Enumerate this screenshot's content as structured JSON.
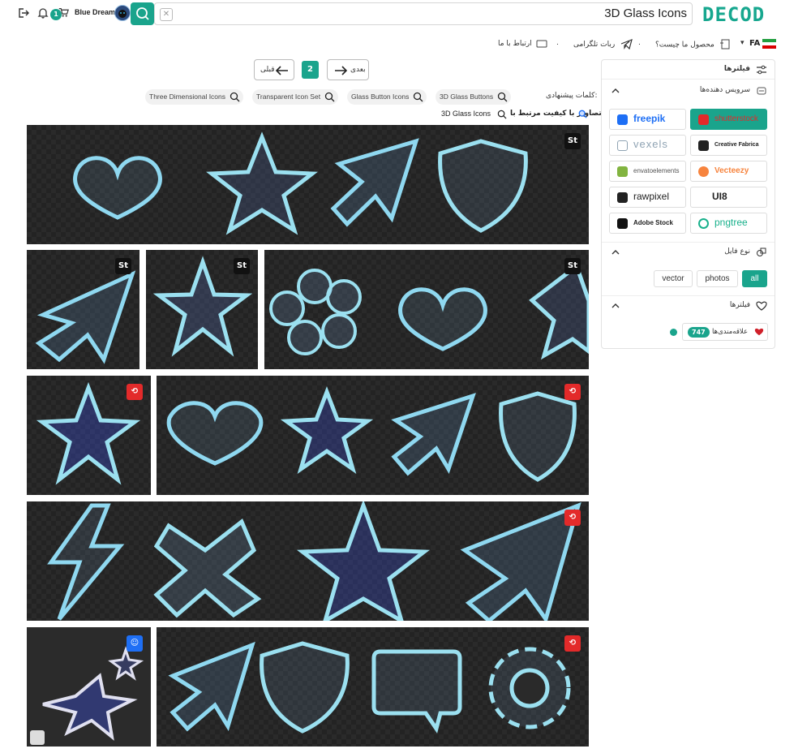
{
  "header": {
    "notification_count": "1",
    "username": "Blue Dream",
    "search_value": "3D Glass Icons",
    "clear_symbol": "✕",
    "logo_text": "DECOD"
  },
  "nav": {
    "lang": "FA",
    "items": [
      "محصول ما چیست؟",
      "ربات تلگرامی",
      "ارتباط با ما"
    ],
    "separator": "."
  },
  "pagination": {
    "prev_label": "قبلی",
    "next_label": "بعدی",
    "current_page": "2"
  },
  "suggestions": {
    "label": "کلمات پیشنهادی:",
    "tags": [
      "Three Dimensional Icons",
      "Transparent Icon Set",
      "Glass Button Icons",
      "3D Glass Buttons"
    ],
    "related_label": "تصاویر با کیفیت مرتبط با",
    "related_query": "3D Glass Icons"
  },
  "results": {
    "tiles": [
      {
        "source": "shutterstock-badge-icon",
        "badge": "St",
        "row": 1
      },
      {
        "source": "adobe-stock-badge-icon",
        "badge": "St",
        "row": 2
      },
      {
        "source": "adobe-stock-badge-icon",
        "badge": "St",
        "row": 2
      },
      {
        "source": "adobe-stock-badge-icon",
        "badge": "St",
        "row": 2
      },
      {
        "source": "shutterstock-badge-icon",
        "badge": "",
        "row": 3
      },
      {
        "source": "shutterstock-badge-icon",
        "badge": "",
        "row": 3
      },
      {
        "source": "shutterstock-badge-icon",
        "badge": "",
        "row": 4
      },
      {
        "source": "freepik-badge-icon",
        "badge": "",
        "row": 5
      },
      {
        "source": "shutterstock-badge-icon",
        "badge": "",
        "row": 5
      }
    ]
  },
  "sidebar": {
    "filters_title": "فیلترها",
    "providers_title": "سرویس دهنده‌ها",
    "providers": [
      {
        "name": "freepik",
        "color": "#1e6ff5",
        "active": false
      },
      {
        "name": "shutterstock",
        "color": "#ffffff",
        "active": true
      },
      {
        "name": "vexels",
        "color": "#8fa3b3",
        "active": false
      },
      {
        "name": "Creative Fabrica",
        "color": "#222222",
        "active": false
      },
      {
        "name": "envatoelements",
        "color": "#82b440",
        "active": false
      },
      {
        "name": "Vecteezy",
        "color": "#f7843e",
        "active": false
      },
      {
        "name": "rawpixel",
        "color": "#222222",
        "active": false
      },
      {
        "name": "UI8",
        "color": "#222222",
        "active": false
      },
      {
        "name": "Adobe Stock",
        "color": "#222222",
        "active": false
      },
      {
        "name": "pngtree",
        "color": "#18b08b",
        "active": false
      }
    ],
    "filetype_title": "نوع فایل",
    "filetypes": [
      {
        "label": "vector",
        "active": false
      },
      {
        "label": "photos",
        "active": false
      },
      {
        "label": "all",
        "active": true
      }
    ],
    "favorites_title": "فیلترها",
    "favorites_label": "علاقه‌مندی‌ها",
    "favorites_count": "747"
  },
  "colors": {
    "accent": "#1aa48c",
    "shutterstock_red": "#e32a2a",
    "freepik_blue": "#1e6ff5"
  }
}
